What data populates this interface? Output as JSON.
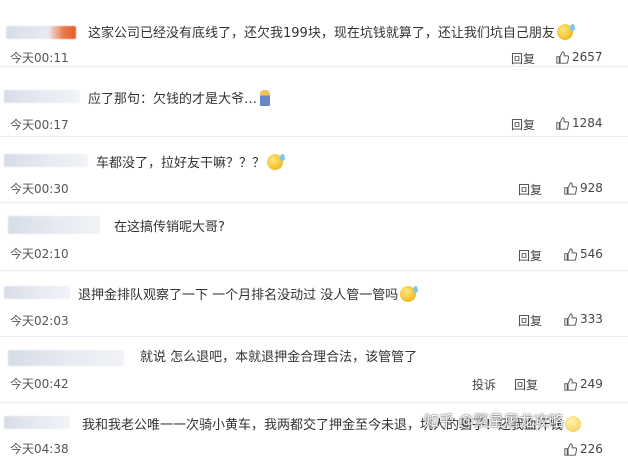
{
  "comments": [
    {
      "text": "这家公司已经没有底线了，还欠我199块，现在坑钱就算了，还让我们坑自己朋友",
      "emoji": "laughing-tears-emoji",
      "time": "今天00:11",
      "reply_label": "回复",
      "likes": "2657"
    },
    {
      "text": "应了那句：欠钱的才是大爷…",
      "emoji": "figure-emoji",
      "time": "今天00:17",
      "reply_label": "回复",
      "likes": "1284"
    },
    {
      "text": "车都没了，拉好友干嘛？？？",
      "emoji": "sweat-emoji",
      "time": "今天00:30",
      "reply_label": "回复",
      "likes": "928"
    },
    {
      "text": "在这搞传销呢大哥?",
      "time": "今天02:10",
      "reply_label": "回复",
      "likes": "546"
    },
    {
      "text": "退押金排队观察了一下 一个月排名没动过 没人管一管吗",
      "emoji": "laughing-tears-emoji",
      "time": "今天02:03",
      "reply_label": "回复",
      "likes": "333"
    },
    {
      "text": "就说 怎么退吧，本就退押金合理合法，该管管了",
      "time": "今天00:42",
      "report_label": "投诉",
      "reply_label": "回复",
      "likes": "249"
    },
    {
      "text": "我和我老公唯一一次骑小黄车，我两都交了押金至今未退，坑人的骗子！还我血汗钱",
      "emoji": "pale-face-emoji",
      "time": "今天04:38",
      "likes": "226"
    }
  ],
  "watermark": "知乎 @繁星屠龙攻略"
}
